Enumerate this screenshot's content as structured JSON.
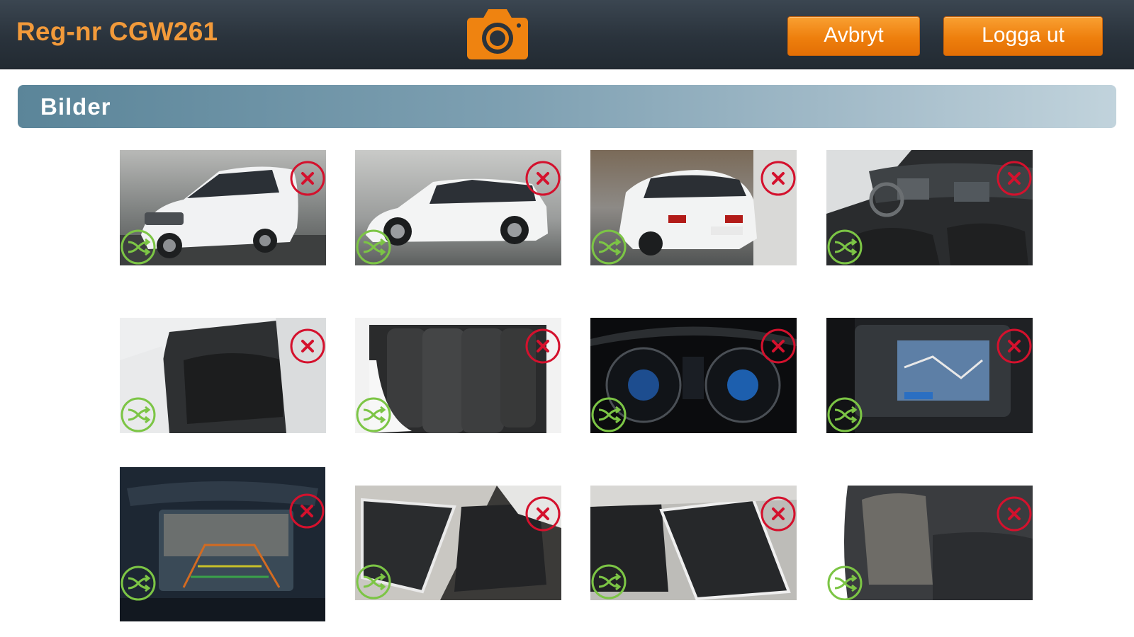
{
  "header": {
    "title": "Reg-nr CGW261",
    "camera_icon": "camera-icon",
    "cancel_label": "Avbryt",
    "logout_label": "Logga ut",
    "accent": "#ef8310"
  },
  "section": {
    "title": "Bilder"
  },
  "gallery": {
    "delete_icon": "close-circle-icon",
    "reorder_icon": "shuffle-icon",
    "delete_color": "#d4112d",
    "reorder_color": "#7cc545",
    "photos": [
      {
        "subject": "exterior-front"
      },
      {
        "subject": "exterior-side"
      },
      {
        "subject": "exterior-rear"
      },
      {
        "subject": "interior-dashboard"
      },
      {
        "subject": "interior-rear-seats"
      },
      {
        "subject": "trunk-with-tires"
      },
      {
        "subject": "instrument-cluster"
      },
      {
        "subject": "navigation-screen"
      },
      {
        "subject": "backup-camera-screen"
      },
      {
        "subject": "open-doors-left"
      },
      {
        "subject": "open-doors-right"
      },
      {
        "subject": "rear-seat-detail"
      }
    ]
  }
}
